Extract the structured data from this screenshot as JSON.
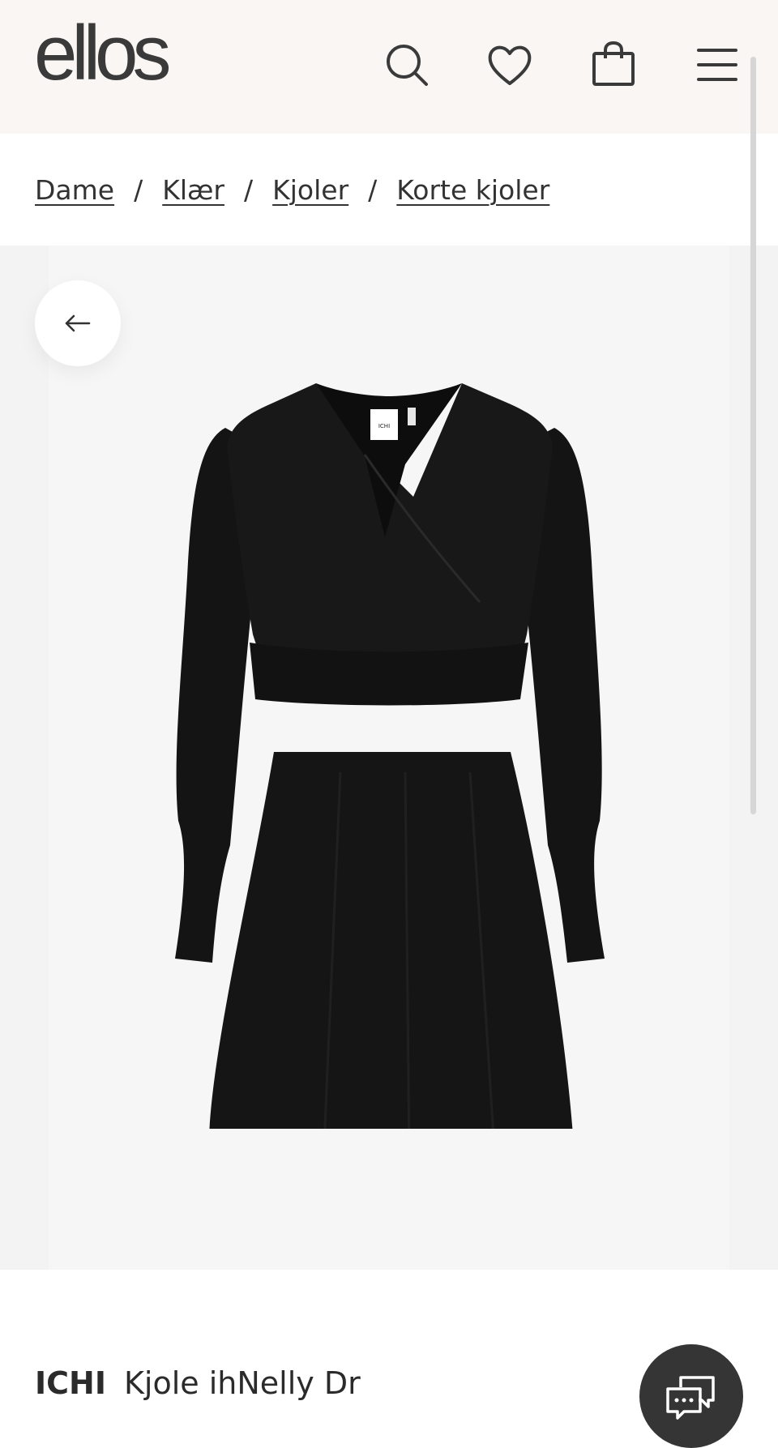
{
  "header": {
    "logo": "ellos",
    "icons": [
      "search-icon",
      "heart-icon",
      "shopping-bag-icon",
      "menu-icon"
    ],
    "background_color": "#f9f6f3"
  },
  "breadcrumb": {
    "items": [
      "Dame",
      "Klær",
      "Kjoler",
      "Korte kjoler"
    ],
    "separator": "/"
  },
  "gallery": {
    "back_icon": "arrow-left-icon",
    "product_image": "black wrap dress",
    "image_label": "ICHI"
  },
  "product": {
    "brand": "ICHI",
    "name": "Kjole ihNelly Dr"
  },
  "chat": {
    "icon": "chat-bubble-icon",
    "color": "#353535"
  }
}
